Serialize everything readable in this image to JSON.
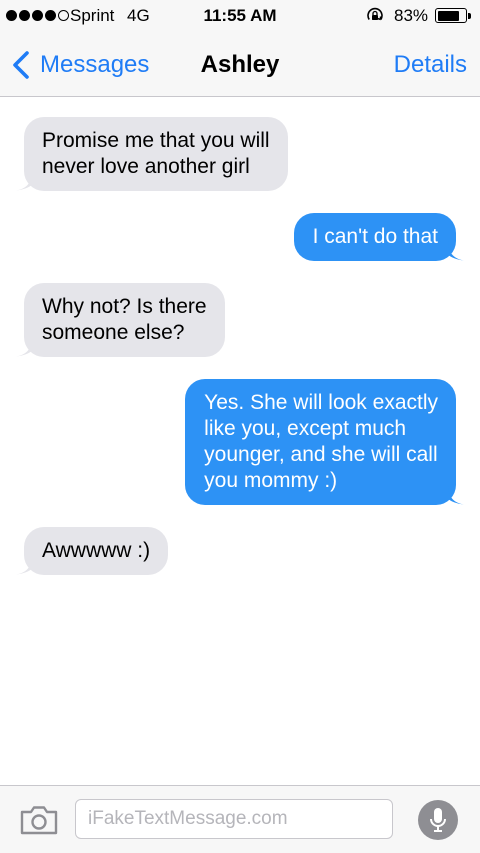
{
  "status_bar": {
    "carrier": "Sprint",
    "network": "4G",
    "time": "11:55 AM",
    "battery_percent": "83%",
    "battery_level": 0.83,
    "signal_bars": 4,
    "signal_total": 5
  },
  "nav": {
    "back_label": "Messages",
    "title": "Ashley",
    "details_label": "Details"
  },
  "messages": [
    {
      "direction": "received",
      "text": "Promise me that you will\nnever love another girl"
    },
    {
      "direction": "sent",
      "text": "I can't do that"
    },
    {
      "direction": "received",
      "text": "Why not? Is there\nsomeone else?"
    },
    {
      "direction": "sent",
      "text": "Yes. She will look exactly\nlike you, except much\nyounger, and she will call\nyou mommy :)"
    },
    {
      "direction": "received",
      "text": "Awwwww :)"
    }
  ],
  "input": {
    "placeholder": "iFakeTextMessage.com"
  },
  "colors": {
    "accent": "#1f7cf6",
    "sent_bubble": "#2d92f5",
    "received_bubble": "#e5e5ea"
  },
  "icons": {
    "back": "chevron-left-icon",
    "camera": "camera-icon",
    "mic": "microphone-icon",
    "lock": "rotation-lock-icon",
    "battery": "battery-icon"
  }
}
